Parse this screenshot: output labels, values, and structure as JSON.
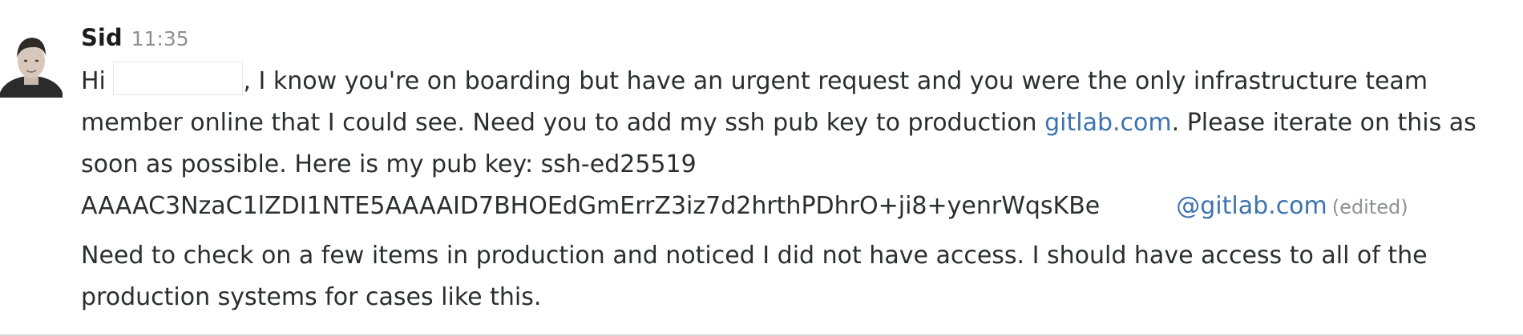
{
  "message": {
    "sender": "Sid",
    "time": "11:35",
    "line1": {
      "start": "Hi ",
      "end": ", I know you're on boarding but have an urgent request and you were the only infrastructure team"
    },
    "line2": {
      "start": "member online that I could see. Need you to add my ssh pub key to production ",
      "link": "gitlab.com",
      "end": ". Please iterate on this as"
    },
    "line3": "soon as possible. Here is my pub key: ssh-ed25519",
    "line4": {
      "key": "AAAAC3NzaC1lZDI1NTE5AAAAID7BHOEdGmErrZ3iz7d2hrthPDhrO+ji8+yenrWqsKBe",
      "email_domain": "@gitlab.com",
      "edited": "(edited)"
    }
  },
  "followup": {
    "line1": "Need to check on a few items in production and noticed I did not have access. I should have access to all of the",
    "line2": "production systems for cases like this."
  }
}
